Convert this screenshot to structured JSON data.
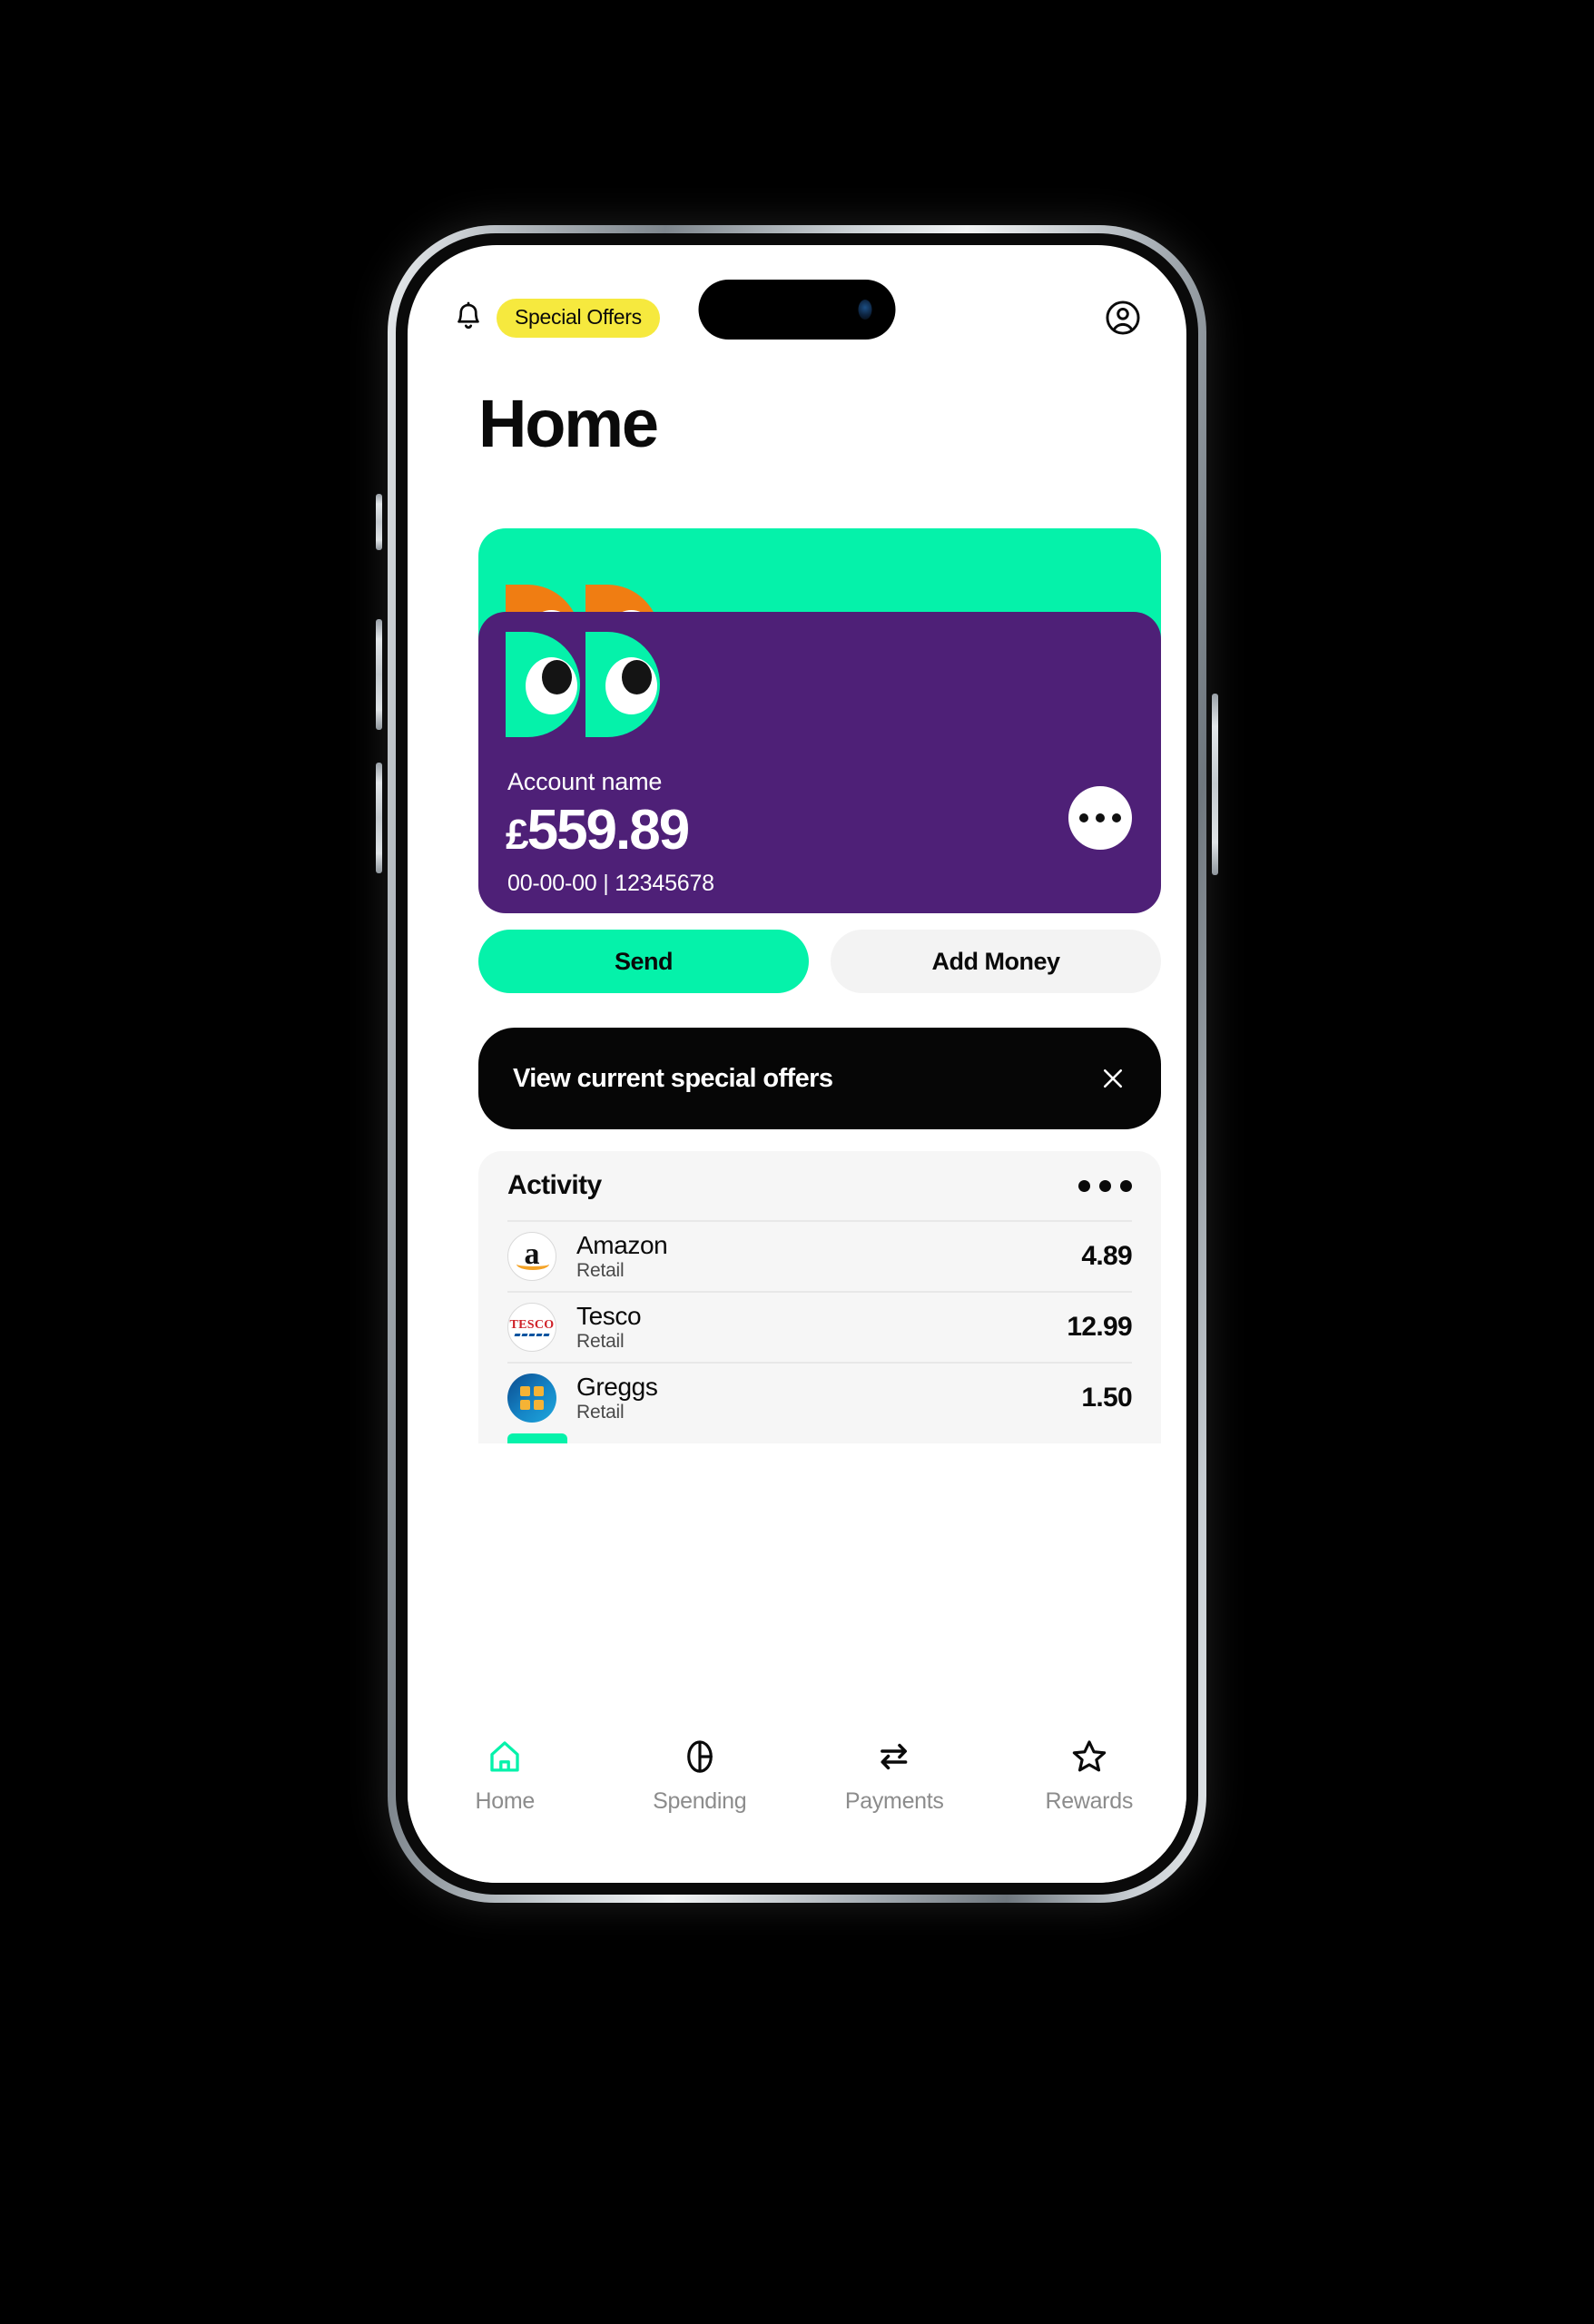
{
  "header": {
    "bell_icon": "bell-icon",
    "special_offers_badge": "Special Offers",
    "profile_icon": "profile-avatar-icon"
  },
  "page": {
    "title": "Home"
  },
  "card": {
    "logo_name": "dd-eyes-logo",
    "account_name": "Account name",
    "currency_symbol": "£",
    "balance": "559.89",
    "account_number": "00-00-00 | 12345678",
    "more_button": "more-options",
    "front_color": "#4E2077",
    "back_color": "#05F2AA",
    "back_logo_color": "#F07D12"
  },
  "actions": {
    "send_label": "Send",
    "add_money_label": "Add Money",
    "send_color": "#05F2AA",
    "add_money_color": "#F3F3F3"
  },
  "offers_banner": {
    "text": "View current special offers",
    "close_icon": "close-icon",
    "background": "#060606"
  },
  "activity": {
    "title": "Activity",
    "menu_icon": "ellipsis-icon",
    "transactions": [
      {
        "merchant": "Amazon",
        "category": "Retail",
        "amount": "4.89",
        "icon": "amazon-logo-icon"
      },
      {
        "merchant": "Tesco",
        "category": "Retail",
        "amount": "12.99",
        "icon": "tesco-logo-icon"
      },
      {
        "merchant": "Greggs",
        "category": "Retail",
        "amount": "1.50",
        "icon": "greggs-logo-icon"
      }
    ]
  },
  "bottom_nav": {
    "items": [
      {
        "label": "Home",
        "icon": "home-icon",
        "active": true
      },
      {
        "label": "Spending",
        "icon": "pie-chart-icon",
        "active": false
      },
      {
        "label": "Payments",
        "icon": "transfer-arrows-icon",
        "active": false
      },
      {
        "label": "Rewards",
        "icon": "star-icon",
        "active": false
      }
    ],
    "active_color": "#05F2AA",
    "inactive_color": "#0a0a0a"
  }
}
